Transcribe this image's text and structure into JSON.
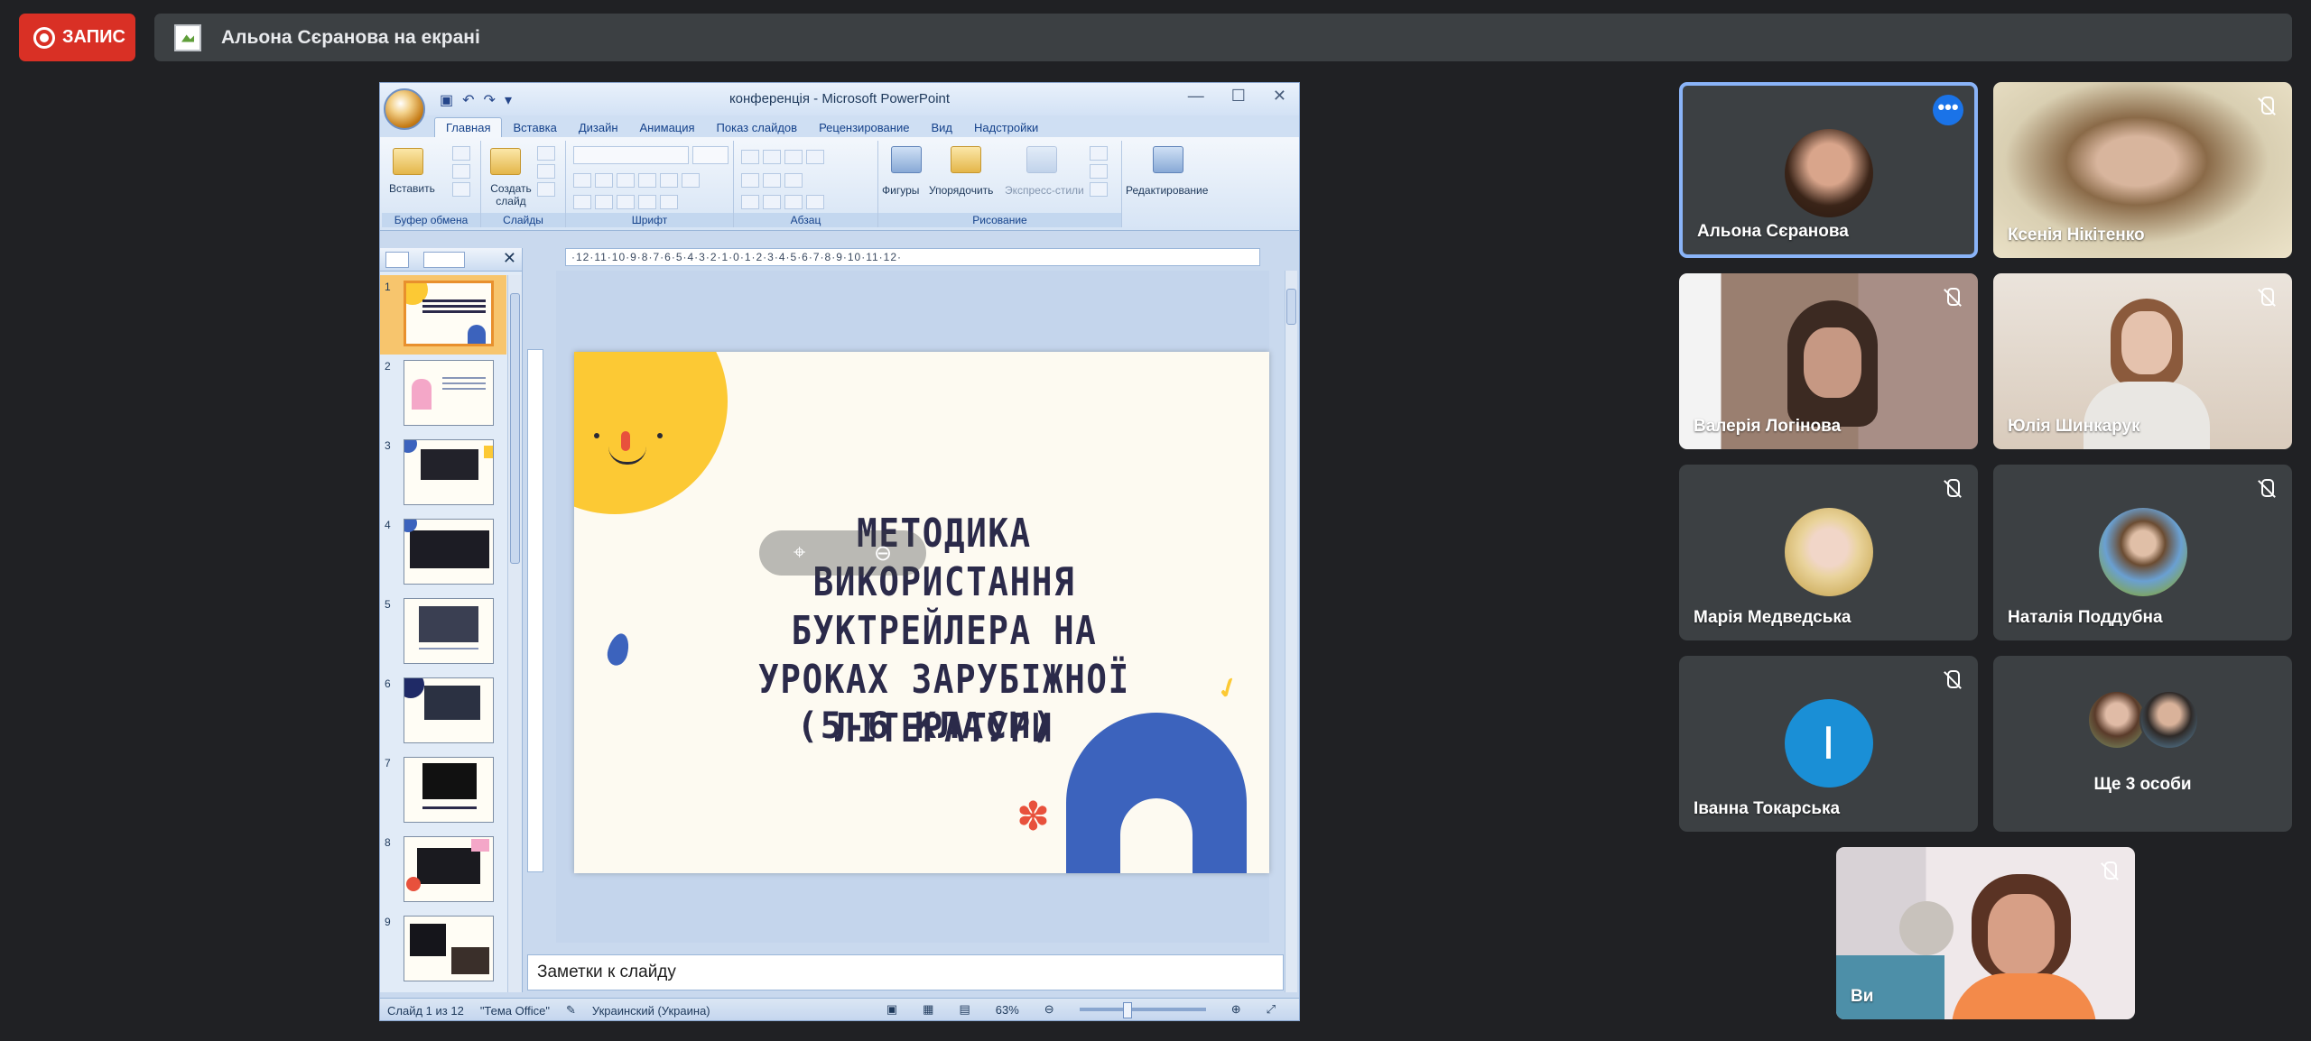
{
  "topbar": {
    "record_label": "ЗАПИС",
    "presenting_text": "Альона Сєранова на екрані"
  },
  "ppt": {
    "window_title": "конференція - Microsoft PowerPoint",
    "tabs": [
      "Главная",
      "Вставка",
      "Дизайн",
      "Анимация",
      "Показ слайдов",
      "Рецензирование",
      "Вид",
      "Надстройки"
    ],
    "groups": {
      "clipboard": "Буфер обмена",
      "slides": "Слайды",
      "font": "Шрифт",
      "paragraph": "Абзац",
      "drawing": "Рисование"
    },
    "buttons": {
      "paste": "Вставить",
      "new_slide": "Создать слайд",
      "shapes": "Фигуры",
      "arrange": "Упорядочить",
      "quick_styles": "Экспресс-стили",
      "editing": "Редактирование"
    },
    "ruler_text": "·12·11·10·9·8·7·6·5·4·3·2·1·0·1·2·3·4·5·6·7·8·9·10·11·12·",
    "slide_numbers": [
      "1",
      "2",
      "3",
      "4",
      "5",
      "6",
      "7",
      "8",
      "9"
    ],
    "slide": {
      "title": "МЕТОДИКА ВИКОРИСТАННЯ БУКТРЕЙЛЕРА НА УРОКАХ ЗАРУБІЖНОЇ ЛІТЕРАТУРИ",
      "subtitle": "(5-6 КЛАСИ)"
    },
    "notes_placeholder": "Заметки к слайду",
    "status": {
      "slide_of": "Слайд 1 из 12",
      "theme": "\"Тема Office\"",
      "language": "Украинский (Украина)",
      "zoom": "63%"
    }
  },
  "participants": [
    {
      "name": "Альона Сєранова",
      "muted": false,
      "active": true
    },
    {
      "name": "Ксенія Нікітенко",
      "muted": true
    },
    {
      "name": "Валерія Логінова",
      "muted": true
    },
    {
      "name": "Юлія Шинкарук",
      "muted": true
    },
    {
      "name": "Марія Медведська",
      "muted": true
    },
    {
      "name": "Наталія Поддубна",
      "muted": true
    },
    {
      "name": "Іванна Токарська",
      "muted": true,
      "initial": "І"
    },
    {
      "name": "Ще 3 особи"
    },
    {
      "name": "Ви",
      "muted": true
    }
  ],
  "colors": {
    "record": "#d93025",
    "tile_bg": "#3c4043",
    "active_border": "#8ab4f8",
    "more_button": "#1a73e8"
  }
}
